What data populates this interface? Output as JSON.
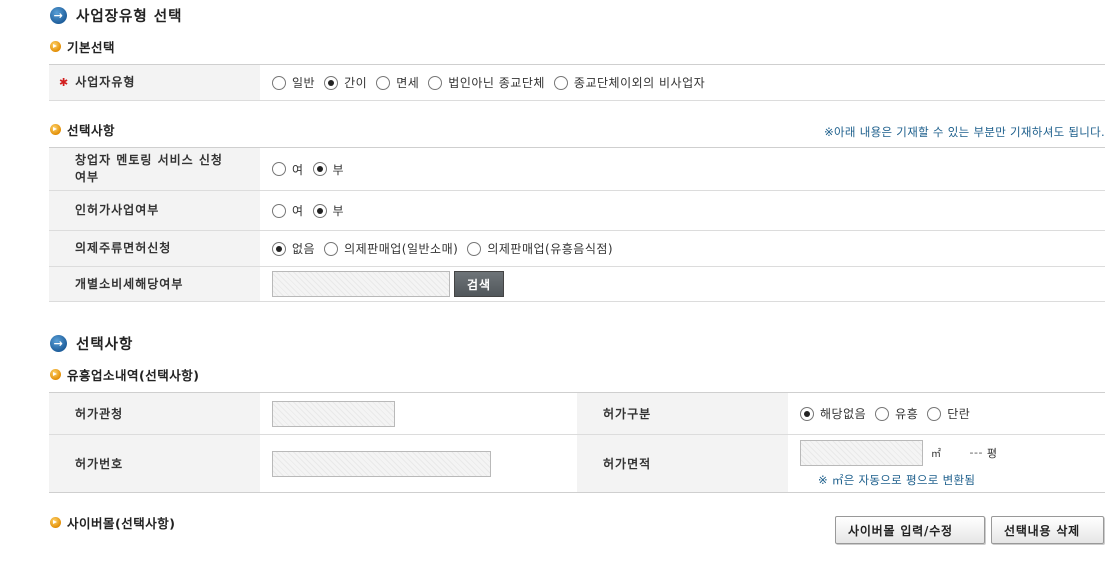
{
  "section1": {
    "title": "사업장유형 선택",
    "basic": {
      "title": "기본선택",
      "business_type": {
        "label": "사업자유형",
        "options": [
          "일반",
          "간이",
          "면세",
          "법인아닌 종교단체",
          "종교단체이외의 비사업자"
        ],
        "selected": "간이"
      }
    },
    "optional": {
      "title": "선택사항",
      "note": "※아래 내용은 기재할 수 있는 부분만 기재하셔도 됩니다.",
      "mentoring": {
        "label_line1": "창업자 멘토링 서비스 신청",
        "label_line2": "여부",
        "options": [
          "여",
          "부"
        ],
        "selected": "부"
      },
      "license_business": {
        "label": "인허가사업여부",
        "options": [
          "여",
          "부"
        ],
        "selected": "부"
      },
      "liquor": {
        "label": "의제주류면허신청",
        "options": [
          "없음",
          "의제판매업(일반소매)",
          "의제판매업(유흥음식점)"
        ],
        "selected": "없음"
      },
      "excise": {
        "label": "개별소비세해당여부",
        "input_value": "",
        "search_button": "검색"
      }
    }
  },
  "section2": {
    "title": "선택사항",
    "entertainment": {
      "title": "유흥업소내역(선택사항)",
      "permit_office": {
        "label": "허가관청",
        "value": ""
      },
      "permit_type": {
        "label": "허가구분",
        "options": [
          "해당없음",
          "유흥",
          "단란"
        ],
        "selected": "해당없음"
      },
      "permit_number": {
        "label": "허가번호",
        "value": ""
      },
      "permit_area": {
        "label": "허가면적",
        "value": "",
        "unit": "㎡",
        "pyeong_value": "---",
        "pyeong_unit": "평",
        "note": "※ ㎡은 자동으로 평으로 변환됨"
      }
    },
    "cybermall": {
      "title": "사이버몰(선택사항)",
      "input_button": "사이버몰 입력/수정",
      "delete_button": "선택내용 삭제"
    }
  },
  "colors": {
    "note_text": "#1d5f8c",
    "required_star": "#d21f1f",
    "search_button": "#5a6064",
    "label_bg": "#f3f3f3"
  }
}
